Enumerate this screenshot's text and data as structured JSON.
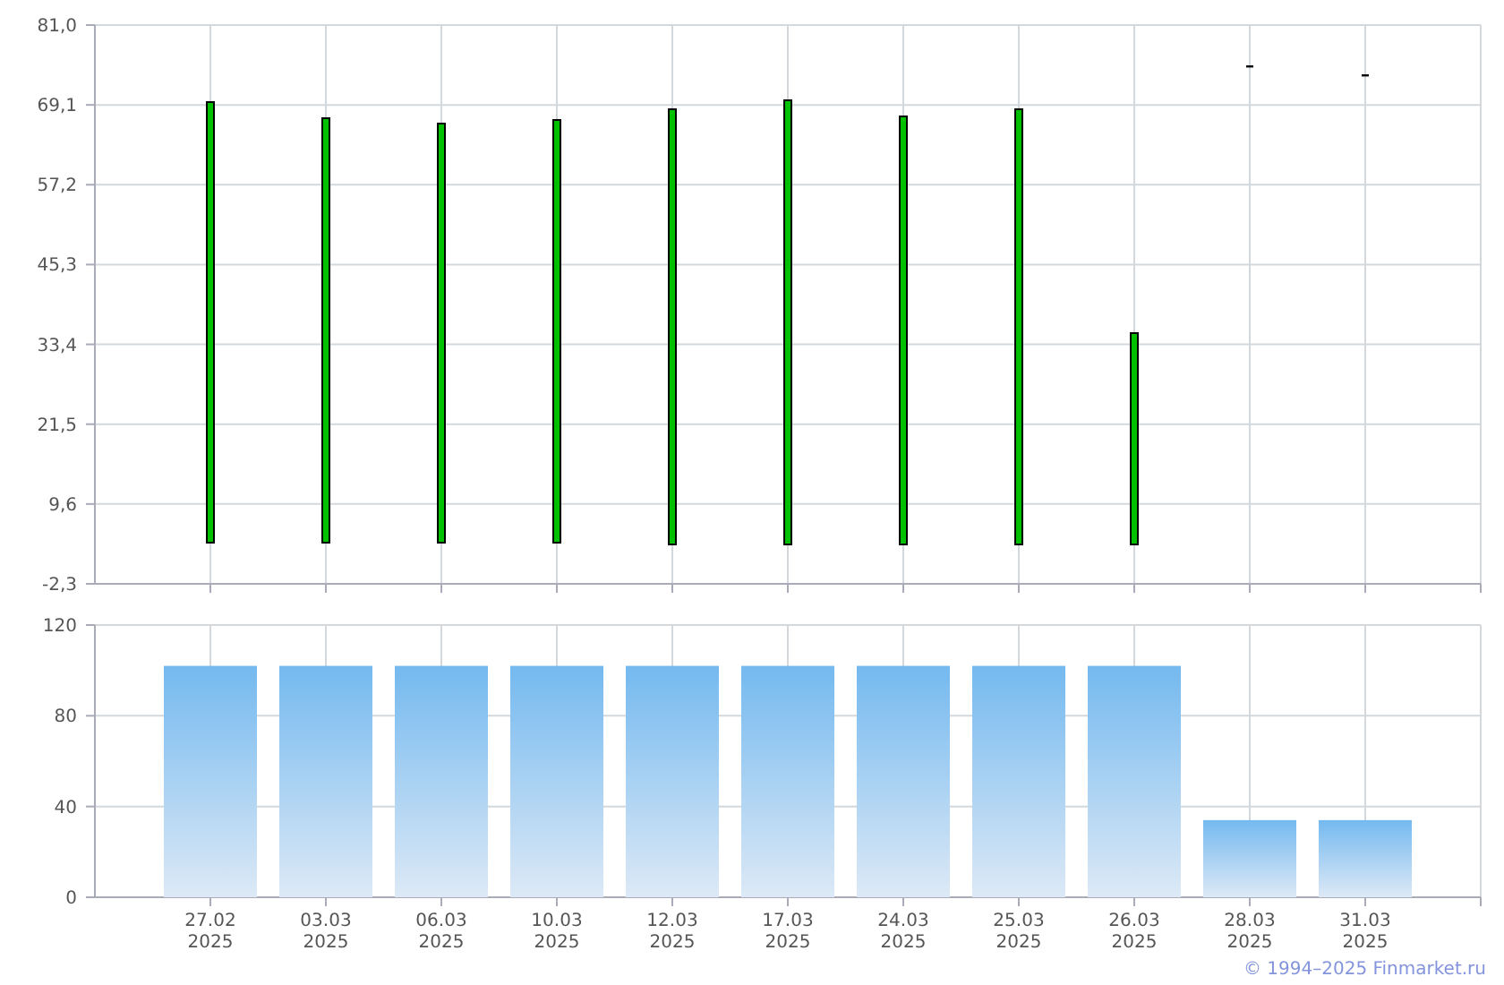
{
  "price_chart": {
    "axis_labels": [
      "81,0",
      "69,1",
      "57,2",
      "45,3",
      "33,4",
      "21,5",
      "9,6",
      "-2,3"
    ]
  },
  "volume_chart": {
    "chart_data": {
      "type": "bar",
      "grid": true,
      "ylim": [
        0,
        120
      ],
      "yticks": [
        0,
        40,
        80,
        120
      ],
      "categories": [
        "27.02 2025",
        "03.03 2025",
        "06.03 2025",
        "10.03 2025",
        "12.03 2025",
        "17.03 2025",
        "24.03 2025",
        "25.03 2025",
        "26.03 2025",
        "28.03 2025",
        "31.03 2025"
      ],
      "series": [
        {
          "color": "#74b9ef",
          "values": [
            102,
            102,
            102,
            102,
            102,
            102,
            102,
            102,
            102,
            34,
            34
          ]
        }
      ]
    }
  },
  "footer": {
    "copyright": "© 1994–2025 Finmarket.ru"
  }
}
